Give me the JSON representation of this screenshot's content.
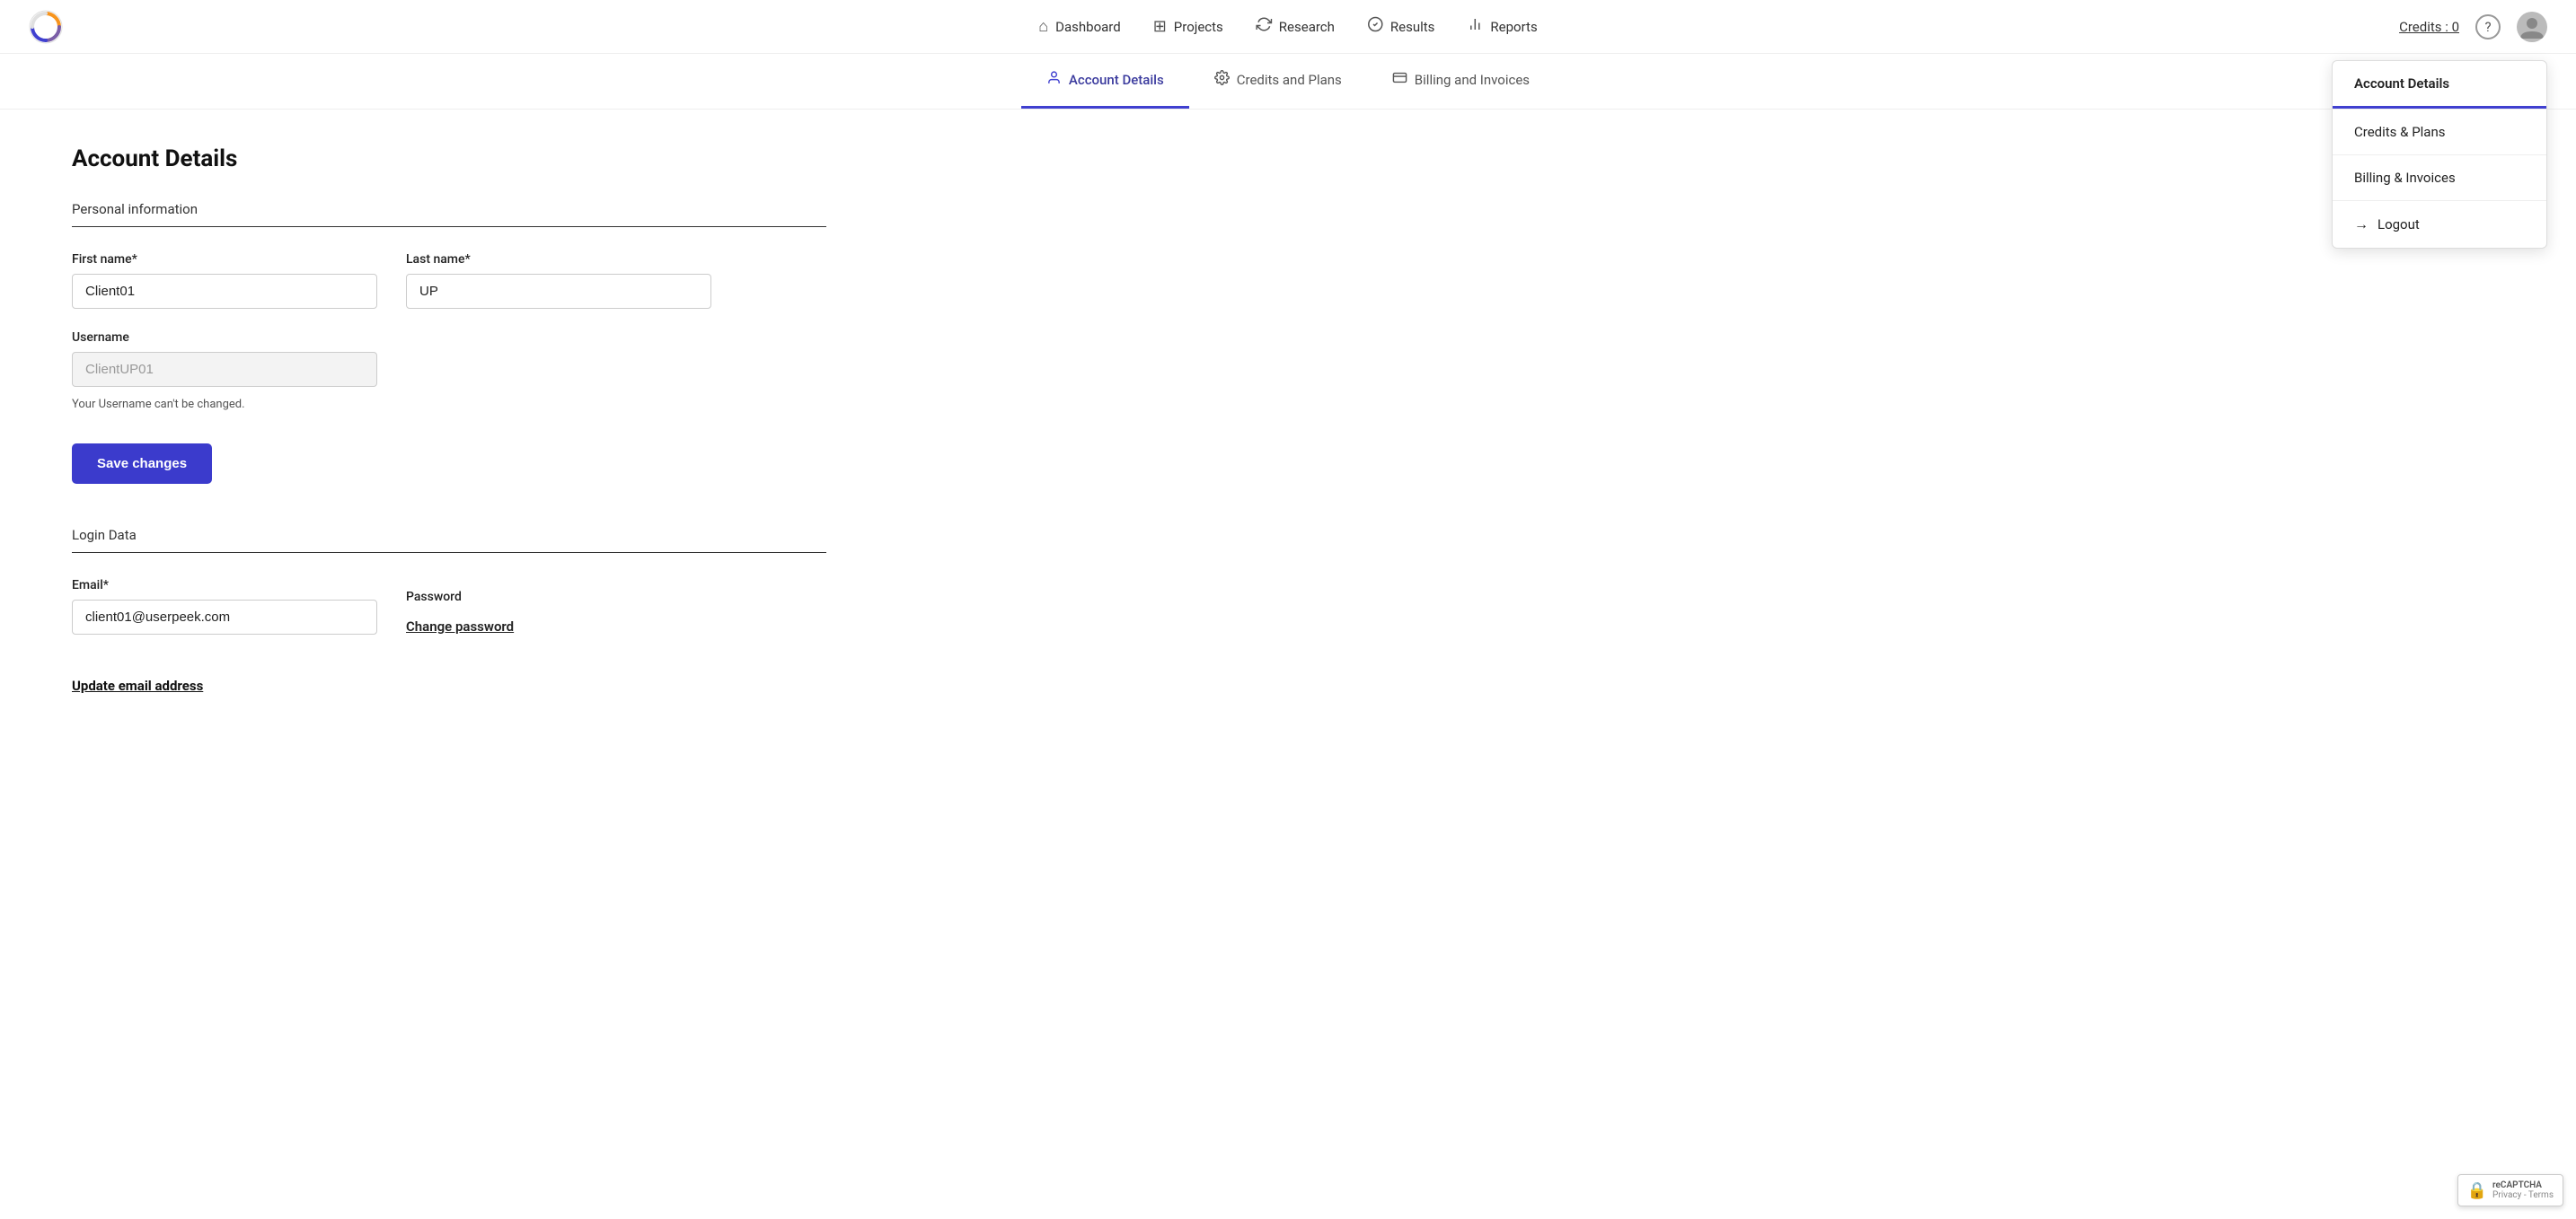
{
  "app": {
    "logo_alt": "UserPeek Logo"
  },
  "topnav": {
    "links": [
      {
        "id": "dashboard",
        "label": "Dashboard",
        "icon": "⌂"
      },
      {
        "id": "projects",
        "label": "Projects",
        "icon": "⊞"
      },
      {
        "id": "research",
        "label": "Research",
        "icon": "↺"
      },
      {
        "id": "results",
        "label": "Results",
        "icon": "✓"
      },
      {
        "id": "reports",
        "label": "Reports",
        "icon": "📊"
      }
    ],
    "credits_label": "Credits : 0",
    "help_icon": "?",
    "avatar_alt": "User Avatar"
  },
  "subnav": {
    "tabs": [
      {
        "id": "account-details",
        "label": "Account Details",
        "icon": "👤",
        "active": true
      },
      {
        "id": "credits-plans",
        "label": "Credits and Plans",
        "icon": "⚙"
      },
      {
        "id": "billing-invoices",
        "label": "Billing and Invoices",
        "icon": "💳"
      }
    ]
  },
  "dropdown": {
    "items": [
      {
        "id": "account-details-menu",
        "label": "Account Details",
        "active": true
      },
      {
        "id": "credits-plans-menu",
        "label": "Credits & Plans"
      },
      {
        "id": "billing-invoices-menu",
        "label": "Billing & Invoices"
      },
      {
        "id": "logout-menu",
        "label": "Logout",
        "icon": "→"
      }
    ]
  },
  "page": {
    "title": "Account Details",
    "personal_section": "Personal information",
    "first_name_label": "First name*",
    "first_name_value": "Client01",
    "last_name_label": "Last name*",
    "last_name_value": "UP",
    "username_label": "Username",
    "username_value": "ClientUP01",
    "username_hint": "Your Username can't be changed.",
    "save_button": "Save changes",
    "login_section": "Login Data",
    "email_label": "Email*",
    "email_value": "client01@userpeek.com",
    "password_label": "Password",
    "change_password_link": "Change password",
    "update_email_link": "Update email address"
  },
  "recaptcha": {
    "text": "reCAPTCHA",
    "subtext": "Privacy - Terms"
  }
}
